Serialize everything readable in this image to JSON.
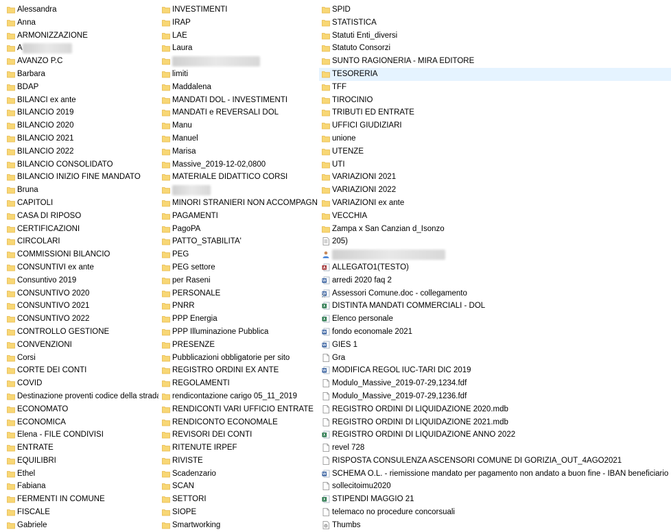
{
  "columns": [
    {
      "items": [
        {
          "label": "Alessandra",
          "icon": "folder-icon"
        },
        {
          "label": "Anna",
          "icon": "folder-icon"
        },
        {
          "label": "ARMONIZZAZIONE",
          "icon": "folder-icon"
        },
        {
          "label": "A",
          "icon": "folder-icon",
          "redacted": true
        },
        {
          "label": "AVANZO P.C",
          "icon": "folder-icon"
        },
        {
          "label": "Barbara",
          "icon": "folder-icon"
        },
        {
          "label": "BDAP",
          "icon": "folder-icon"
        },
        {
          "label": "BILANCI ex ante",
          "icon": "folder-icon"
        },
        {
          "label": "BILANCIO 2019",
          "icon": "folder-icon"
        },
        {
          "label": "BILANCIO 2020",
          "icon": "folder-icon"
        },
        {
          "label": "BILANCIO 2021",
          "icon": "folder-icon"
        },
        {
          "label": "BILANCIO 2022",
          "icon": "folder-icon"
        },
        {
          "label": "BILANCIO CONSOLIDATO",
          "icon": "folder-icon"
        },
        {
          "label": "BILANCIO INIZIO FINE MANDATO",
          "icon": "folder-icon"
        },
        {
          "label": "Bruna",
          "icon": "folder-icon"
        },
        {
          "label": "CAPITOLI",
          "icon": "folder-icon"
        },
        {
          "label": "CASA DI RIPOSO",
          "icon": "folder-icon"
        },
        {
          "label": "CERTIFICAZIONI",
          "icon": "folder-icon"
        },
        {
          "label": "CIRCOLARI",
          "icon": "folder-icon"
        },
        {
          "label": "COMMISSIONI BILANCIO",
          "icon": "folder-icon"
        },
        {
          "label": "CONSUNTIVI ex ante",
          "icon": "folder-icon"
        },
        {
          "label": "Consuntivo 2019",
          "icon": "folder-icon"
        },
        {
          "label": "CONSUNTIVO 2020",
          "icon": "folder-icon"
        },
        {
          "label": "CONSUNTIVO 2021",
          "icon": "folder-icon"
        },
        {
          "label": "CONSUNTIVO 2022",
          "icon": "folder-icon"
        },
        {
          "label": "CONTROLLO GESTIONE",
          "icon": "folder-icon"
        },
        {
          "label": "CONVENZIONI",
          "icon": "folder-icon"
        },
        {
          "label": "Corsi",
          "icon": "folder-icon"
        },
        {
          "label": "CORTE DEI CONTI",
          "icon": "folder-icon"
        },
        {
          "label": "COVID",
          "icon": "folder-icon"
        },
        {
          "label": "Destinazione proventi codice della strada",
          "icon": "folder-icon"
        },
        {
          "label": "ECONOMATO",
          "icon": "folder-icon"
        },
        {
          "label": "ECONOMICA",
          "icon": "folder-icon"
        },
        {
          "label": "Elena - FILE CONDIVISI",
          "icon": "folder-icon"
        },
        {
          "label": "ENTRATE",
          "icon": "folder-icon"
        },
        {
          "label": "EQUILIBRI",
          "icon": "folder-icon"
        },
        {
          "label": "Ethel",
          "icon": "folder-icon"
        },
        {
          "label": "Fabiana",
          "icon": "folder-icon"
        },
        {
          "label": "FERMENTI IN COMUNE",
          "icon": "folder-icon"
        },
        {
          "label": "FISCALE",
          "icon": "folder-icon"
        },
        {
          "label": "Gabriele",
          "icon": "folder-icon"
        }
      ]
    },
    {
      "items": [
        {
          "label": "INVESTIMENTI",
          "icon": "folder-icon"
        },
        {
          "label": "IRAP",
          "icon": "folder-icon"
        },
        {
          "label": "LAE",
          "icon": "folder-icon"
        },
        {
          "label": "Laura",
          "icon": "folder-icon"
        },
        {
          "label": "",
          "icon": "folder-icon",
          "redacted": true
        },
        {
          "label": "limiti",
          "icon": "folder-icon"
        },
        {
          "label": "Maddalena",
          "icon": "folder-icon"
        },
        {
          "label": "MANDATI DOL - INVESTIMENTI",
          "icon": "folder-icon"
        },
        {
          "label": "MANDATI e REVERSALI DOL",
          "icon": "folder-icon"
        },
        {
          "label": "Manu",
          "icon": "folder-icon"
        },
        {
          "label": "Manuel",
          "icon": "folder-icon"
        },
        {
          "label": "Marisa",
          "icon": "folder-icon"
        },
        {
          "label": "Massive_2019-12-02,0800",
          "icon": "folder-icon"
        },
        {
          "label": "MATERIALE DIDATTICO CORSI",
          "icon": "folder-icon"
        },
        {
          "label": "",
          "icon": "folder-icon",
          "redacted": true
        },
        {
          "label": "MINORI STRANIERI NON ACCOMPAGNATI",
          "icon": "folder-icon"
        },
        {
          "label": "PAGAMENTI",
          "icon": "folder-icon"
        },
        {
          "label": "PagoPA",
          "icon": "folder-icon"
        },
        {
          "label": "PATTO_STABILITA'",
          "icon": "folder-icon"
        },
        {
          "label": "PEG",
          "icon": "folder-icon"
        },
        {
          "label": "PEG settore",
          "icon": "folder-icon"
        },
        {
          "label": "per Raseni",
          "icon": "folder-icon"
        },
        {
          "label": "PERSONALE",
          "icon": "folder-icon"
        },
        {
          "label": "PNRR",
          "icon": "folder-icon"
        },
        {
          "label": "PPP Energia",
          "icon": "folder-icon"
        },
        {
          "label": "PPP Illuminazione Pubblica",
          "icon": "folder-icon"
        },
        {
          "label": "PRESENZE",
          "icon": "folder-icon"
        },
        {
          "label": "Pubblicazioni obbligatorie per sito",
          "icon": "folder-icon"
        },
        {
          "label": "REGISTRO ORDINI EX ANTE",
          "icon": "folder-icon"
        },
        {
          "label": "REGOLAMENTI",
          "icon": "folder-icon"
        },
        {
          "label": "rendicontazione carigo 05_11_2019",
          "icon": "folder-icon"
        },
        {
          "label": "RENDICONTI VARI UFFICIO ENTRATE",
          "icon": "folder-icon"
        },
        {
          "label": "RENDICONTO ECONOMALE",
          "icon": "folder-icon"
        },
        {
          "label": "REVISORI DEI CONTI",
          "icon": "folder-icon"
        },
        {
          "label": "RITENUTE IRPEF",
          "icon": "folder-icon"
        },
        {
          "label": "RIVISTE",
          "icon": "folder-icon"
        },
        {
          "label": "Scadenzario",
          "icon": "folder-icon"
        },
        {
          "label": "SCAN",
          "icon": "folder-icon"
        },
        {
          "label": "SETTORI",
          "icon": "folder-icon"
        },
        {
          "label": "SIOPE",
          "icon": "folder-icon"
        },
        {
          "label": "Smartworking",
          "icon": "folder-icon"
        }
      ]
    },
    {
      "items": [
        {
          "label": "SPID",
          "icon": "folder-icon"
        },
        {
          "label": "STATISTICA",
          "icon": "folder-icon"
        },
        {
          "label": "Statuti Enti_diversi",
          "icon": "folder-icon"
        },
        {
          "label": "Statuto Consorzi",
          "icon": "folder-icon"
        },
        {
          "label": "SUNTO RAGIONERIA - MIRA EDITORE",
          "icon": "folder-icon"
        },
        {
          "label": "TESORERIA",
          "icon": "folder-icon",
          "selected": true
        },
        {
          "label": "TFF",
          "icon": "folder-icon"
        },
        {
          "label": "TIROCINIO",
          "icon": "folder-icon"
        },
        {
          "label": "TRIBUTI ED ENTRATE",
          "icon": "folder-icon"
        },
        {
          "label": "UFFICI GIUDIZIARI",
          "icon": "folder-icon"
        },
        {
          "label": "unione",
          "icon": "folder-icon"
        },
        {
          "label": "UTENZE",
          "icon": "folder-icon"
        },
        {
          "label": "UTI",
          "icon": "folder-icon"
        },
        {
          "label": "VARIAZIONI 2021",
          "icon": "folder-icon"
        },
        {
          "label": "VARIAZIONI 2022",
          "icon": "folder-icon"
        },
        {
          "label": "VARIAZIONI ex ante",
          "icon": "folder-icon"
        },
        {
          "label": "VECCHIA",
          "icon": "folder-icon"
        },
        {
          "label": "Zampa x San Canzian d_Isonzo",
          "icon": "folder-icon"
        },
        {
          "label": "205)",
          "icon": "text-file-icon"
        },
        {
          "label": "",
          "icon": "contact-file-icon",
          "redacted": true
        },
        {
          "label": "ALLEGATO1(TESTO)",
          "icon": "access-file-icon"
        },
        {
          "label": "arredi 2020 faq 2",
          "icon": "word-file-icon"
        },
        {
          "label": "Assessori Comune.doc - collegamento",
          "icon": "word-shortcut-icon"
        },
        {
          "label": "DISTINTA MANDATI COMMERCIALI - DOL",
          "icon": "excel-file-icon"
        },
        {
          "label": "Elenco personale",
          "icon": "excel-file-icon"
        },
        {
          "label": "fondo economale 2021",
          "icon": "word-file-icon"
        },
        {
          "label": "GIES 1",
          "icon": "word-file-icon"
        },
        {
          "label": "Gra",
          "icon": "blank-file-icon"
        },
        {
          "label": "MODIFICA REGOL IUC-TARI DIC 2019",
          "icon": "word-file-icon"
        },
        {
          "label": "Modulo_Massive_2019-07-29,1234.fdf",
          "icon": "blank-file-icon"
        },
        {
          "label": "Modulo_Massive_2019-07-29,1236.fdf",
          "icon": "blank-file-icon"
        },
        {
          "label": "REGISTRO ORDINI DI LIQUIDAZIONE 2020.mdb",
          "icon": "blank-file-icon"
        },
        {
          "label": "REGISTRO ORDINI DI LIQUIDAZIONE 2021.mdb",
          "icon": "blank-file-icon"
        },
        {
          "label": "REGISTRO ORDINI DI LIQUIDAZIONE ANNO 2022",
          "icon": "excel-file-icon"
        },
        {
          "label": "revel 728",
          "icon": "blank-file-icon"
        },
        {
          "label": "RISPOSTA CONSULENZA ASCENSORI COMUNE DI GORIZIA_OUT_4AGO2021",
          "icon": "blank-file-icon"
        },
        {
          "label": "SCHEMA O.L. - riemissione mandato per pagamento non andato a buon fine - IBAN beneficiario errato",
          "icon": "word-file-icon"
        },
        {
          "label": "sollecitoimu2020",
          "icon": "blank-file-icon"
        },
        {
          "label": "STIPENDI MAGGIO 21",
          "icon": "excel-file-icon"
        },
        {
          "label": "telemaco no procedure concorsuali",
          "icon": "blank-file-icon"
        },
        {
          "label": "Thumbs",
          "icon": "system-file-icon"
        }
      ]
    }
  ],
  "colors": {
    "folder": "#f8d775",
    "folder_dark": "#e6b84a",
    "selection": "#e5f3ff",
    "word": "#2b579a",
    "excel": "#217346",
    "access": "#a4373a"
  }
}
